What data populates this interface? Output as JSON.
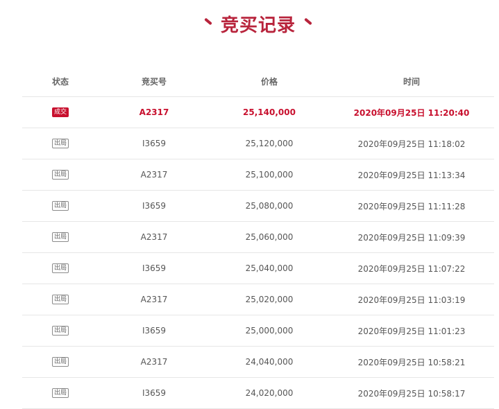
{
  "page": {
    "title": "竞买记录"
  },
  "table": {
    "headers": {
      "status": "状态",
      "bid_no": "竞买号",
      "price": "价格",
      "time": "时间"
    },
    "rows": [
      {
        "status": "成交",
        "bid_no": "A2317",
        "price": "25,140,000",
        "time": "2020年09月25日 11:20:40",
        "deal": true
      },
      {
        "status": "出局",
        "bid_no": "I3659",
        "price": "25,120,000",
        "time": "2020年09月25日 11:18:02",
        "deal": false
      },
      {
        "status": "出局",
        "bid_no": "A2317",
        "price": "25,100,000",
        "time": "2020年09月25日 11:13:34",
        "deal": false
      },
      {
        "status": "出局",
        "bid_no": "I3659",
        "price": "25,080,000",
        "time": "2020年09月25日 11:11:28",
        "deal": false
      },
      {
        "status": "出局",
        "bid_no": "A2317",
        "price": "25,060,000",
        "time": "2020年09月25日 11:09:39",
        "deal": false
      },
      {
        "status": "出局",
        "bid_no": "I3659",
        "price": "25,040,000",
        "time": "2020年09月25日 11:07:22",
        "deal": false
      },
      {
        "status": "出局",
        "bid_no": "A2317",
        "price": "25,020,000",
        "time": "2020年09月25日 11:03:19",
        "deal": false
      },
      {
        "status": "出局",
        "bid_no": "I3659",
        "price": "25,000,000",
        "time": "2020年09月25日 11:01:23",
        "deal": false
      },
      {
        "status": "出局",
        "bid_no": "A2317",
        "price": "24,040,000",
        "time": "2020年09月25日 10:58:21",
        "deal": false
      },
      {
        "status": "出局",
        "bid_no": "I3659",
        "price": "24,020,000",
        "time": "2020年09月25日 10:58:17",
        "deal": false
      }
    ]
  },
  "colors": {
    "accent": "#b8243c",
    "deal_red": "#c8102e",
    "text": "#555555",
    "divider": "#e6e6e6"
  }
}
